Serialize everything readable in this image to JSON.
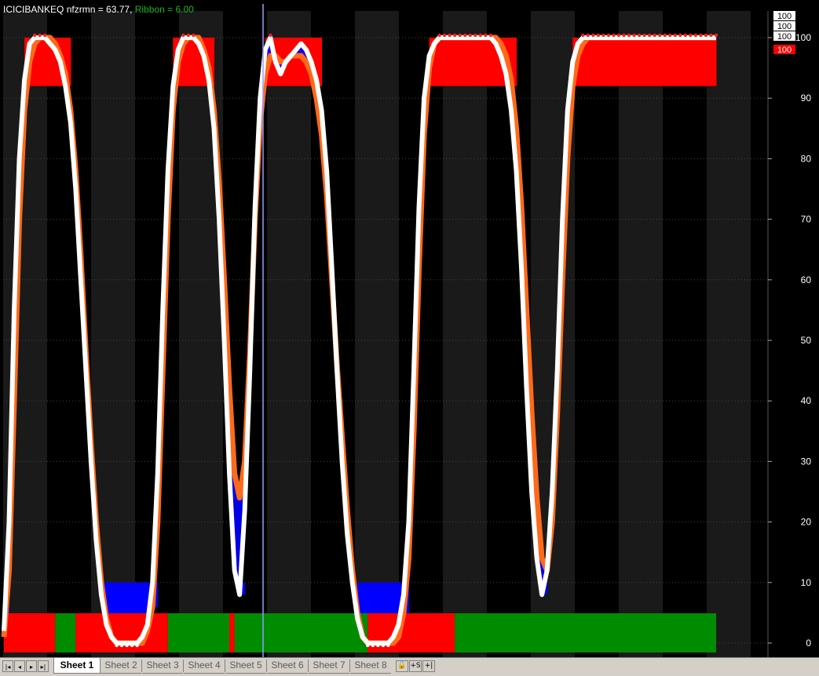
{
  "title": {
    "symbol": "ICICIBANKEQ",
    "indicator_label": "nfzrmn = 63.77,",
    "ribbon_label": "Ribbon = 6.00"
  },
  "colors": {
    "background": "#000000",
    "band": "#1a1a1a",
    "primary_line": "#ffffff",
    "secondary_line": "#ff6a1a",
    "fill_blue": "#0000ff",
    "fill_red": "#ff0000",
    "ribbon_green": "#008c00",
    "ribbon_red": "#ff0000",
    "cursor": "#9a9aff"
  },
  "value_badges": [
    "100",
    "100",
    "100",
    "100"
  ],
  "tabs": [
    {
      "label": "Sheet 1",
      "active": true
    },
    {
      "label": "Sheet 2",
      "active": false
    },
    {
      "label": "Sheet 3",
      "active": false
    },
    {
      "label": "Sheet 4",
      "active": false
    },
    {
      "label": "Sheet 5",
      "active": false
    },
    {
      "label": "Sheet 6",
      "active": false
    },
    {
      "label": "Sheet 7",
      "active": false
    },
    {
      "label": "Sheet 8",
      "active": false
    }
  ],
  "nav_buttons": [
    "|◂",
    "◂",
    "▸",
    "▸|"
  ],
  "tool_buttons": [
    "🔓",
    "+S",
    "+|"
  ],
  "chart_data": {
    "type": "line",
    "ylim": [
      0,
      100
    ],
    "yticks": [
      0,
      10,
      20,
      30,
      40,
      50,
      60,
      70,
      80,
      90,
      100
    ],
    "grid": true,
    "x": [
      0,
      1,
      2,
      3,
      4,
      5,
      6,
      7,
      8,
      9,
      10,
      11,
      12,
      13,
      14,
      15,
      16,
      17,
      18,
      19,
      20,
      21,
      22,
      23,
      24,
      25,
      26,
      27,
      28,
      29,
      30,
      31,
      32,
      33,
      34,
      35,
      36,
      37,
      38,
      39,
      40,
      41,
      42,
      43,
      44,
      45,
      46,
      47,
      48,
      49,
      50,
      51,
      52,
      53,
      54,
      55,
      56,
      57,
      58,
      59,
      60,
      61,
      62,
      63,
      64,
      65,
      66,
      67,
      68,
      69,
      70,
      71,
      72,
      73,
      74,
      75,
      76,
      77,
      78,
      79,
      80,
      81,
      82,
      83,
      84,
      85,
      86,
      87,
      88,
      89,
      90,
      91,
      92,
      93,
      94,
      95,
      96,
      97,
      98,
      99,
      100,
      101,
      102,
      103,
      104,
      105,
      106,
      107,
      108,
      109,
      110,
      111,
      112,
      113,
      114,
      115,
      116,
      117,
      118,
      119,
      120,
      121,
      122,
      123,
      124,
      125,
      126,
      127,
      128,
      129,
      130,
      131,
      132,
      133,
      134,
      135,
      136,
      137,
      138,
      139
    ],
    "series": [
      {
        "values": [
          2,
          20,
          55,
          80,
          93,
          99,
          100,
          100,
          100,
          99,
          98,
          96,
          92,
          86,
          75,
          60,
          45,
          30,
          17,
          8,
          3,
          1,
          0,
          0,
          0,
          0,
          0,
          1,
          3,
          10,
          28,
          55,
          78,
          92,
          98,
          100,
          100,
          100,
          99,
          97,
          93,
          85,
          70,
          50,
          28,
          12,
          8,
          22,
          45,
          72,
          90,
          98,
          100,
          96,
          94,
          96,
          97,
          98,
          99,
          98,
          96,
          93,
          88,
          78,
          62,
          45,
          30,
          18,
          10,
          4,
          1,
          0,
          0,
          0,
          0,
          0,
          1,
          3,
          8,
          20,
          45,
          72,
          90,
          97,
          99,
          100,
          100,
          100,
          100,
          100,
          100,
          100,
          100,
          100,
          100,
          100,
          99,
          97,
          94,
          88,
          78,
          62,
          42,
          25,
          14,
          8,
          12,
          25,
          45,
          70,
          88,
          96,
          99,
          100,
          100,
          100,
          100,
          100,
          100,
          100,
          100,
          100,
          100,
          100,
          100,
          100,
          100,
          100,
          100,
          100,
          100,
          100,
          100,
          100,
          100,
          100,
          100,
          100,
          100,
          100
        ]
      },
      {
        "values": [
          1,
          12,
          40,
          70,
          88,
          96,
          99,
          100,
          100,
          100,
          99,
          97,
          94,
          88,
          78,
          64,
          48,
          33,
          20,
          10,
          4,
          1,
          0,
          0,
          0,
          0,
          0,
          0,
          2,
          6,
          20,
          45,
          70,
          88,
          96,
          99,
          100,
          100,
          100,
          98,
          95,
          88,
          76,
          60,
          42,
          28,
          24,
          30,
          48,
          70,
          86,
          94,
          97,
          97,
          96,
          96,
          97,
          97,
          97,
          96,
          94,
          90,
          84,
          74,
          60,
          46,
          34,
          22,
          12,
          5,
          1,
          0,
          0,
          0,
          0,
          0,
          0,
          1,
          5,
          14,
          35,
          62,
          84,
          95,
          99,
          100,
          100,
          100,
          100,
          100,
          100,
          100,
          100,
          100,
          100,
          100,
          100,
          99,
          97,
          93,
          85,
          72,
          55,
          38,
          24,
          14,
          12,
          20,
          38,
          60,
          80,
          92,
          97,
          99,
          100,
          100,
          100,
          100,
          100,
          100,
          100,
          100,
          100,
          100,
          100,
          100,
          100,
          100,
          100,
          100,
          100,
          100,
          100,
          100,
          100,
          100,
          100,
          100,
          100,
          100
        ]
      }
    ],
    "ribbon_segments": [
      {
        "color": "red",
        "from": 0,
        "to": 10
      },
      {
        "color": "green",
        "from": 10,
        "to": 14
      },
      {
        "color": "red",
        "from": 14,
        "to": 32
      },
      {
        "color": "green",
        "from": 32,
        "to": 44
      },
      {
        "color": "red",
        "from": 44,
        "to": 45
      },
      {
        "color": "green",
        "from": 45,
        "to": 71
      },
      {
        "color": "red",
        "from": 71,
        "to": 88
      },
      {
        "color": "green",
        "from": 88,
        "to": 139
      }
    ]
  }
}
